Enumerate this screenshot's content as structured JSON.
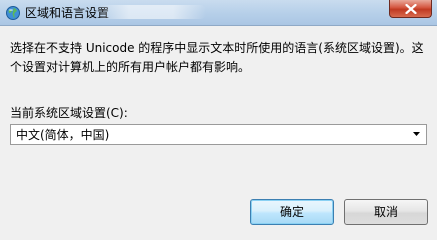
{
  "window": {
    "title": "区域和语言设置",
    "icon": "globe-icon",
    "close_icon": "close-icon"
  },
  "dialog": {
    "description": "选择在不支持 Unicode 的程序中显示文本时所使用的语言(系统区域设置)。这个设置对计算机上的所有用户帐户都有影响。",
    "locale_label": "当前系统区域设置(C):",
    "locale_selected": "中文(简体，中国)"
  },
  "buttons": {
    "ok": "确定",
    "cancel": "取消"
  },
  "colors": {
    "titlebar": "#b9d1ea",
    "background": "#f0f0f0",
    "close_button": "#c03a22",
    "default_button_border": "#3c7fb1"
  }
}
